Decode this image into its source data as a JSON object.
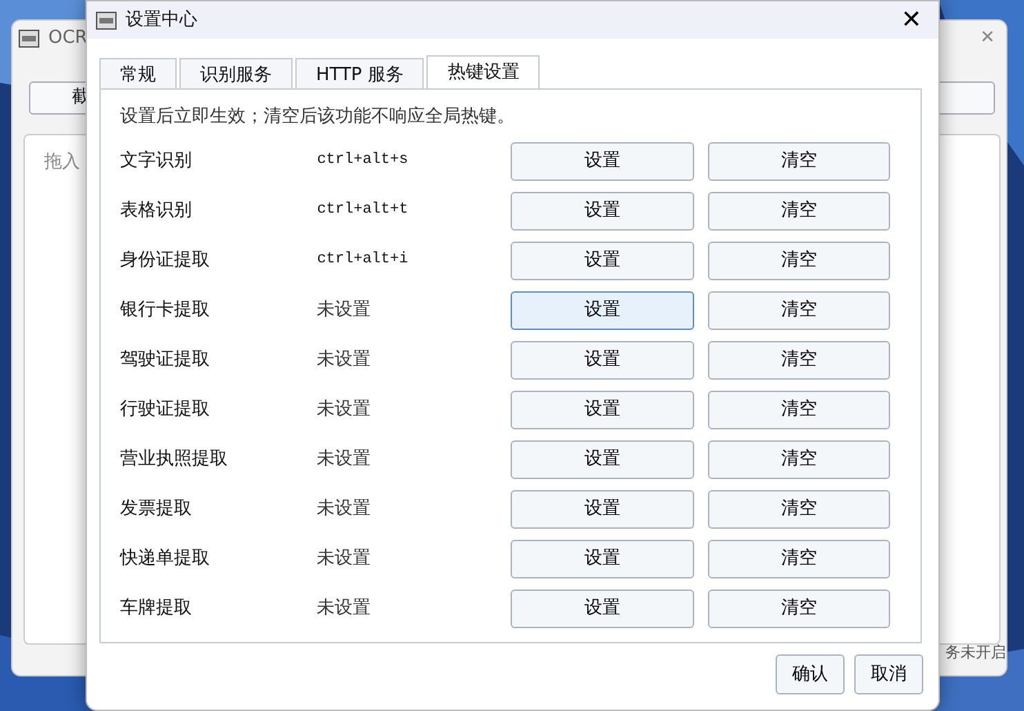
{
  "background_window": {
    "title": "OCR",
    "close": "✕",
    "button": "截",
    "drop_hint": "拖入",
    "status": "务未开启"
  },
  "window": {
    "title": "设置中心",
    "close": "✕"
  },
  "tabs": [
    {
      "label": "常规",
      "selected": false
    },
    {
      "label": "识别服务",
      "selected": false
    },
    {
      "label": "HTTP 服务",
      "selected": false
    },
    {
      "label": "热键设置",
      "selected": true
    }
  ],
  "hint": "设置后立即生效；清空后该功能不响应全局热键。",
  "hotkeys": [
    {
      "name": "文字识别",
      "hotkey": "ctrl+alt+s",
      "set": true,
      "set_button": "设置",
      "clear_button": "清空",
      "hovered": false
    },
    {
      "name": "表格识别",
      "hotkey": "ctrl+alt+t",
      "set": true,
      "set_button": "设置",
      "clear_button": "清空",
      "hovered": false
    },
    {
      "name": "身份证提取",
      "hotkey": "ctrl+alt+i",
      "set": true,
      "set_button": "设置",
      "clear_button": "清空",
      "hovered": false
    },
    {
      "name": "银行卡提取",
      "hotkey": "未设置",
      "set": false,
      "set_button": "设置",
      "clear_button": "清空",
      "hovered": true
    },
    {
      "name": "驾驶证提取",
      "hotkey": "未设置",
      "set": false,
      "set_button": "设置",
      "clear_button": "清空",
      "hovered": false
    },
    {
      "name": "行驶证提取",
      "hotkey": "未设置",
      "set": false,
      "set_button": "设置",
      "clear_button": "清空",
      "hovered": false
    },
    {
      "name": "营业执照提取",
      "hotkey": "未设置",
      "set": false,
      "set_button": "设置",
      "clear_button": "清空",
      "hovered": false
    },
    {
      "name": "发票提取",
      "hotkey": "未设置",
      "set": false,
      "set_button": "设置",
      "clear_button": "清空",
      "hovered": false
    },
    {
      "name": "快递单提取",
      "hotkey": "未设置",
      "set": false,
      "set_button": "设置",
      "clear_button": "清空",
      "hovered": false
    },
    {
      "name": "车牌提取",
      "hotkey": "未设置",
      "set": false,
      "set_button": "设置",
      "clear_button": "清空",
      "hovered": false
    }
  ],
  "buttons": [
    "确认",
    "取消"
  ]
}
